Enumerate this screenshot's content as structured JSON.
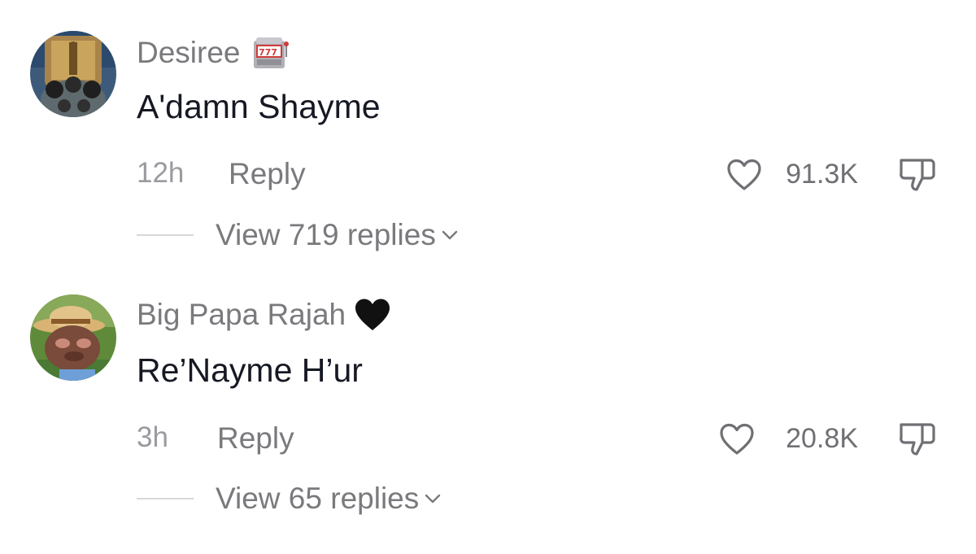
{
  "comments": [
    {
      "username": "Desiree",
      "badge_icon": "slot-machine-icon",
      "text": "A'damn Shayme",
      "time": "12h",
      "reply_label": "Reply",
      "like_count": "91.3K",
      "view_replies_label": "View 719 replies"
    },
    {
      "username": "Big Papa Rajah",
      "badge_icon": "black-heart-icon",
      "text": "Re’Nayme H’ur",
      "time": "3h",
      "reply_label": "Reply",
      "like_count": "20.8K",
      "view_replies_label": "View 65 replies"
    }
  ],
  "icons": {
    "like": "heart-outline-icon",
    "dislike": "thumbs-down-icon",
    "expand": "chevron-down-icon"
  },
  "colors": {
    "text_primary": "#161823",
    "text_secondary": "#7a7a7e",
    "divider": "#d8d8da"
  }
}
